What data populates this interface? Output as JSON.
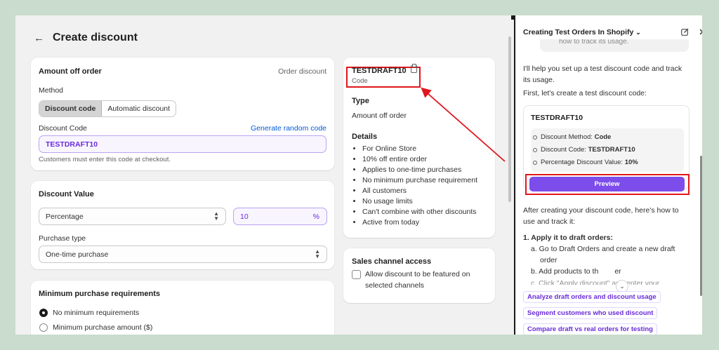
{
  "page": {
    "back_label": "←",
    "title": "Create discount"
  },
  "amount_card": {
    "title": "Amount off order",
    "type_label": "Order discount",
    "method_label": "Method",
    "method_options": [
      "Discount code",
      "Automatic discount"
    ],
    "method_selected": "Discount code",
    "code_label": "Discount Code",
    "generate_link": "Generate random code",
    "code_value": "TESTDRAFT10",
    "help_text": "Customers must enter this code at checkout."
  },
  "value_card": {
    "title": "Discount Value",
    "value_type": "Percentage",
    "value": "10",
    "value_suffix": "%",
    "purchase_type_label": "Purchase type",
    "purchase_type": "One-time purchase"
  },
  "requirements_card": {
    "title": "Minimum purchase requirements",
    "options": [
      "No minimum requirements",
      "Minimum purchase amount ($)"
    ],
    "selected": "No minimum requirements"
  },
  "summary_card": {
    "code": "TESTDRAFT10",
    "code_caption": "Code",
    "type_heading": "Type",
    "type_value": "Amount off order",
    "details_heading": "Details",
    "details": [
      "For Online Store",
      "10% off entire order",
      "Applies to one-time purchases",
      "No minimum purchase requirement",
      "All customers",
      "No usage limits",
      "Can't combine with other discounts",
      "Active from today"
    ]
  },
  "sales_channel_card": {
    "title": "Sales channel access",
    "checkbox_line1": "Allow discount to be featured on",
    "checkbox_line2": "selected channels"
  },
  "assistant": {
    "title": "Creating Test Orders In Shopify",
    "prev_message_fragment": "how to track its usage.",
    "intro_line1": "I'll help you set up a test discount code and track",
    "intro_line2": "its usage.",
    "first_line": "First, let's create a test discount code:",
    "card_title": "TESTDRAFT10",
    "details": [
      {
        "label": "Discount Method: ",
        "value": "Code"
      },
      {
        "label": "Discount Code: ",
        "value": "TESTDRAFT10"
      },
      {
        "label": "Percentage Discount Value: ",
        "value": "10%"
      }
    ],
    "preview_button": "Preview",
    "after_line1": "After creating your discount code, here's how to",
    "after_line2": "use and track it:",
    "step1_title": "1. Apply it to draft orders:",
    "step_a_line1": "a. Go to Draft Orders and create a new draft",
    "step_a_line2": "order",
    "step_b_pre": "b. Add products to th",
    "step_b_post": "er",
    "step_c_partial": "c. Click \"Apply discount\" and enter your",
    "suggestions": [
      "Analyze draft orders and discount usage",
      "Segment customers who used discount",
      "Compare draft vs real orders for testing"
    ]
  },
  "colors": {
    "accent_purple": "#7c4dea",
    "highlight_red": "#e0171c",
    "link_blue": "#005bd3",
    "background_green": "#c9dccd"
  }
}
